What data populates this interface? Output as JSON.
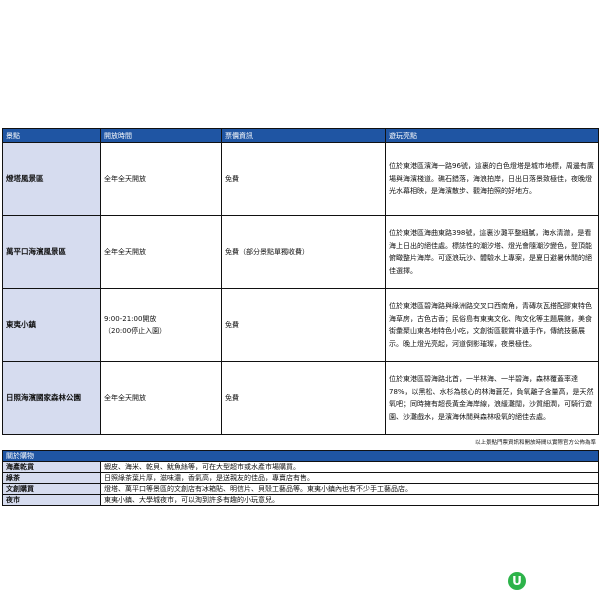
{
  "headers": [
    "景點",
    "開放時間",
    "票價資訊",
    "遊玩亮點"
  ],
  "rows": [
    {
      "name": "燈塔風景區",
      "hours": "全年全天開放",
      "price": "免費",
      "highlight": "位於東港區濱海一路96號，這裏的白色燈塔是城市地標，周邊有廣場與海濱棧道。礁石錯落，海浪拍岸，日出日落景致極佳，夜晚燈光水幕相映，是海濱散步、觀海拍照的好地方。"
    },
    {
      "name": "萬平口海濱風景區",
      "hours": "全年全天開放",
      "price": "免費（部分景點單獨收費）",
      "highlight": "位於東港區海曲東路398號，這裏沙灘平整細膩，海水清澈，是看海上日出的絕佳處。標誌性的潮汐塔、燈光會隨潮汐變色，登頂能俯瞰整片海岸。可逐浪玩沙、體驗水上專案，是夏日避暑休閒的絕佳選擇。"
    },
    {
      "name": "東夷小鎮",
      "hours": "9:00-21:00開放\n（20:00停止入園）",
      "price": "免費",
      "highlight": "位於東港區碧海路與綠洲路交叉口西南角，青磚灰瓦搭配膠東特色海草房，古色古香；民俗島有東夷文化、陶文化等主題展館，美食街彙聚山東各地特色小吃，文創街區觀賞非遺手作，傳統技藝展示。晚上燈光亮起，河道倒影璀璨，夜景極佳。"
    },
    {
      "name": "日照海濱國家森林公園",
      "hours": "全年全天開放",
      "price": "免費",
      "highlight": "位於東港區碧海路北首，一半林海、一半碧海，森林覆蓋率達78%，以黑松、水杉為核心的林海蒼茫，負氧離子含量高，是天然氧吧；同時擁有超長黃金海岸線，浪緩灘闊，沙質細潤，可騎行遊園、沙灘戲水，是濱海休閒與森林吸氧的絕佳去處。"
    }
  ],
  "note": "以上景點門票資訊和開放時間以實際官方公佈為準",
  "shopping": {
    "title": "關於購物",
    "items": [
      {
        "category": "海產乾貨",
        "desc": "蝦皮、海米、乾貝、魷魚絲等，可在大型超市或水產市場購買。"
      },
      {
        "category": "綠茶",
        "desc": "日照綠茶葉片厚，滋味濃，香氣高，是送親友的佳品，專賣店有售。"
      },
      {
        "category": "文創購買",
        "desc": "燈塔、萬平口等景區的文創店有冰箱貼、明信片、貝殼工藝品等。東夷小鎮內也有不少手工藝品店。"
      },
      {
        "category": "夜市",
        "desc": "東夷小鎮、大學城夜市，可以淘到許多有趣的小玩意兒。"
      }
    ]
  },
  "colors": {
    "header": "#1f55a3",
    "name_cell": "#d6dcef",
    "logo": "#2db34a"
  },
  "logo_glyph": "U"
}
